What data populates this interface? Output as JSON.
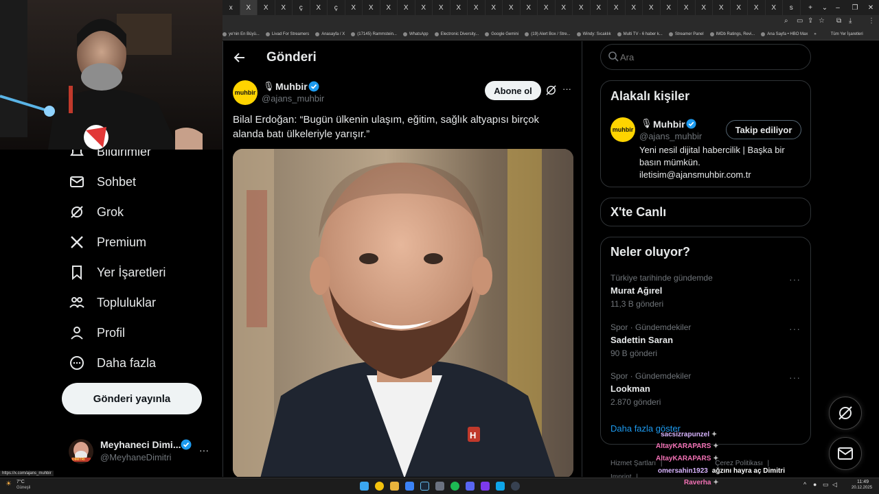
{
  "browser": {
    "tab_glyphs": [
      "x",
      "X",
      "X",
      "X",
      "ç",
      "X",
      "ç",
      "X",
      "X",
      "X",
      "X",
      "X",
      "X",
      "X",
      "X",
      "X",
      "X",
      "X",
      "X",
      "X",
      "X",
      "X",
      "X",
      "X",
      "X",
      "X",
      "X",
      "X",
      "X",
      "X",
      "X",
      "X",
      "s"
    ],
    "new_tab": "+",
    "bookmarks": [
      "ye'nin En Büyü...",
      "Livad For Streamers",
      "Anasayfa / X",
      "(17145) Rammstein...",
      "WhatsApp",
      "Electronic Diversity...",
      "Google Gemini",
      "(19) Alert Box / Stre...",
      "Windy: Sıcaklık",
      "Multi TV - 6 haber k...",
      "Streamer Panel",
      "IMDb Ratings, Revi...",
      "Ana Sayfa • HBO Max"
    ],
    "bookmarks_more": "»",
    "all_bookmarks": "Tüm Yer İşaretleri",
    "status_url": "https://x.com/ajans_muhbir"
  },
  "nav": {
    "items": [
      {
        "label": "Bildirimler",
        "icon": "bell-icon"
      },
      {
        "label": "Sohbet",
        "icon": "mail-icon"
      },
      {
        "label": "Grok",
        "icon": "grok-icon"
      },
      {
        "label": "Premium",
        "icon": "x-logo-icon"
      },
      {
        "label": "Yer İşaretleri",
        "icon": "bookmark-icon"
      },
      {
        "label": "Topluluklar",
        "icon": "communities-icon"
      },
      {
        "label": "Profil",
        "icon": "profile-icon"
      },
      {
        "label": "Daha fazla",
        "icon": "more-circle-icon"
      }
    ],
    "post_button": "Gönderi yayınla",
    "account": {
      "name": "Meyhaneci Dimi...",
      "handle": "@MeyhaneDimitri",
      "avatar_text": "DİMİTRİ",
      "more": "···"
    }
  },
  "header": {
    "title": "Gönderi"
  },
  "post": {
    "avatar_text": "muhbir",
    "author_name": "Muhbir",
    "author_handle": "@ajans_muhbir",
    "subscribe_label": "Abone ol",
    "more": "···",
    "text": "Bilal Erdoğan: “Bugün ülkenin ulaşım, eğitim, sağlık altyapısı birçok alanda batı ülkeleriyle yarışır.”"
  },
  "search": {
    "placeholder": "Ara"
  },
  "related": {
    "title": "Alakalı kişiler",
    "name": "Muhbir",
    "handle": "@ajans_muhbir",
    "avatar_text": "muhbir",
    "follow_label": "Takip ediliyor",
    "bio": "Yeni nesil dijital habercilik | Başka bir basın mümkün. iletisim@ajansmuhbir.com.tr"
  },
  "live": {
    "title": "X'te Canlı"
  },
  "trends": {
    "title": "Neler oluyor?",
    "items": [
      {
        "meta": "Türkiye tarihinde gündemde",
        "name": "Murat Ağırel",
        "count": "11,3 B gönderi"
      },
      {
        "meta": "Spor · Gündemdekiler",
        "name": "Sadettin Saran",
        "count": "90 B gönderi"
      },
      {
        "meta": "Spor · Gündemdekiler",
        "name": "Lookman",
        "count": "2.870 gönderi"
      }
    ],
    "show_more": "Daha fazla göster",
    "more": "···"
  },
  "footer": {
    "links": [
      "Hizmet Şartları",
      "|",
      "Çerez Politikası",
      "|",
      "Imprint",
      "|"
    ]
  },
  "chat": [
    {
      "user": "sacsizrapunzel",
      "message": "",
      "color": "#d8b4fe"
    },
    {
      "user": "AltayKARAPARS",
      "message": "",
      "color": "#f472b6"
    },
    {
      "user": "AltayKARAPARS",
      "message": "",
      "color": "#f472b6"
    },
    {
      "user": "omersahin1923",
      "message": "ağzını hayra aç Dimitri",
      "color": "#d8b4fe"
    },
    {
      "user": "Raverha",
      "message": "",
      "color": "#f472b6"
    }
  ],
  "taskbar": {
    "weather_temp": "7°C",
    "weather_desc": "Güneşli",
    "time": "11:49",
    "date": "20.12.2025"
  },
  "colors": {
    "accent": "#1d9bf0",
    "muhbir_yellow": "#ffd400",
    "bg": "#000000",
    "border": "#2f3336",
    "muted": "#71767b"
  }
}
